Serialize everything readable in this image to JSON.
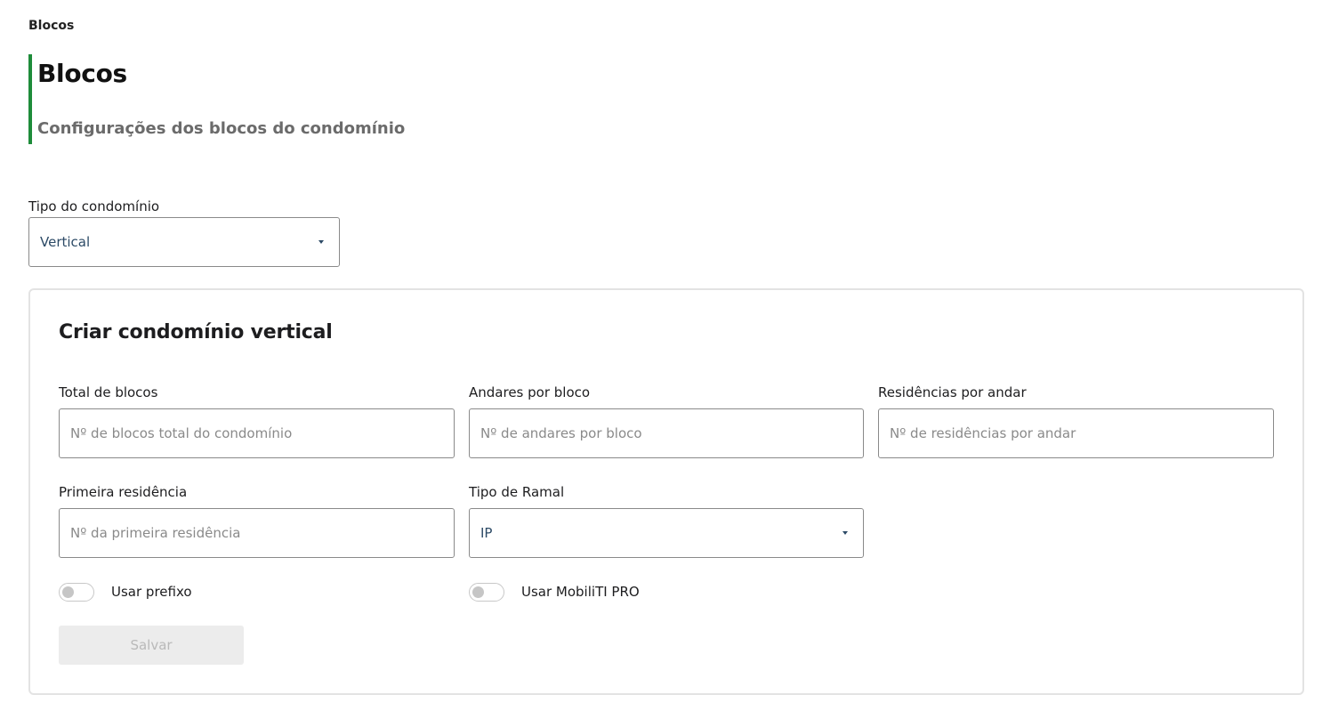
{
  "breadcrumb": "Blocos",
  "header": {
    "title": "Blocos",
    "subtitle": "Configurações dos blocos do condomínio"
  },
  "condo_type": {
    "label": "Tipo do condomínio",
    "value": "Vertical"
  },
  "card": {
    "title": "Criar condomínio vertical",
    "fields": {
      "total_blocks": {
        "label": "Total de blocos",
        "placeholder": "Nº de blocos total do condomínio"
      },
      "floors_per_block": {
        "label": "Andares por bloco",
        "placeholder": "Nº de andares por bloco"
      },
      "residences_per_floor": {
        "label": "Residências por andar",
        "placeholder": "Nº de residências por andar"
      },
      "first_residence": {
        "label": "Primeira residência",
        "placeholder": "Nº da primeira residência"
      },
      "extension_type": {
        "label": "Tipo de Ramal",
        "value": "IP"
      }
    },
    "toggles": {
      "prefix": {
        "label": "Usar prefixo",
        "on": false
      },
      "mobiliti_pro": {
        "label": "Usar MobiliTI PRO",
        "on": false
      }
    },
    "save_label": "Salvar"
  },
  "colors": {
    "accent": "#1e8c3a",
    "select_text": "#2c4a66",
    "disabled_button_bg": "#ececec",
    "disabled_button_text": "#b9b9b9"
  }
}
